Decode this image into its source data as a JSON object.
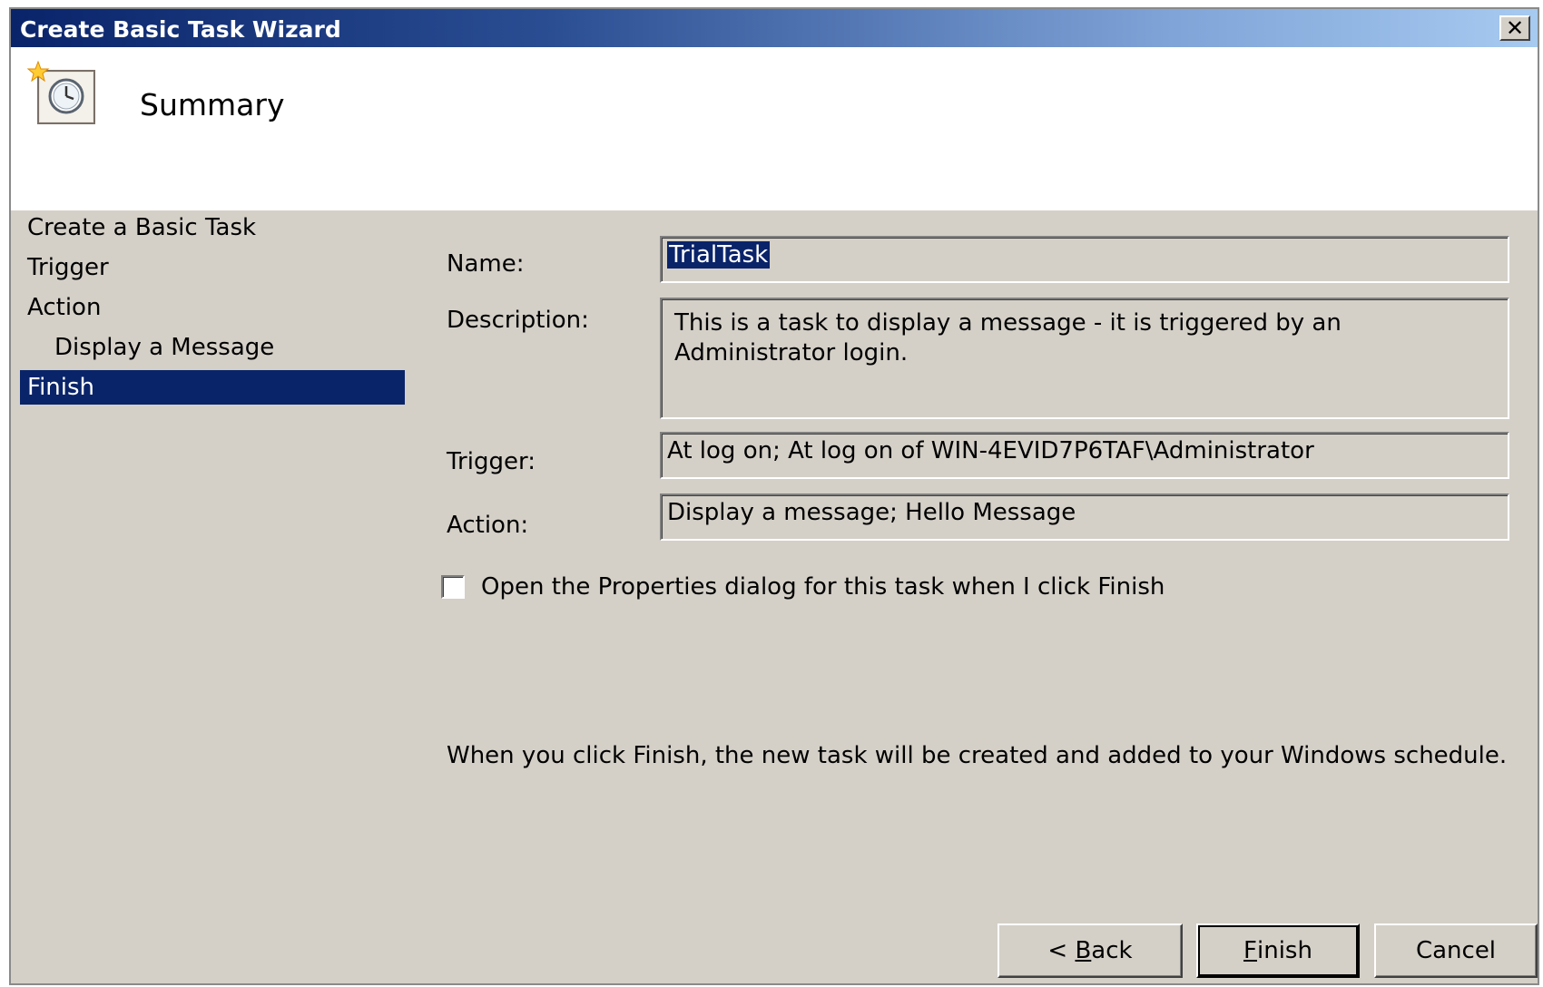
{
  "window": {
    "title": "Create Basic Task Wizard",
    "close_label": "✕"
  },
  "header": {
    "page_title": "Summary"
  },
  "steps": [
    {
      "label": "Create a Basic Task",
      "level": 0,
      "active": false
    },
    {
      "label": "Trigger",
      "level": 0,
      "active": false
    },
    {
      "label": "Action",
      "level": 0,
      "active": false
    },
    {
      "label": "Display a Message",
      "level": 1,
      "active": false
    },
    {
      "label": "Finish",
      "level": 0,
      "active": true
    }
  ],
  "form": {
    "name_label": "Name:",
    "name_value": "TrialTask",
    "description_label": "Description:",
    "description_value": "This is a task to display a message - it is triggered by an Administrator login.",
    "trigger_label": "Trigger:",
    "trigger_value": "At log on; At log on of WIN-4EVID7P6TAF\\Administrator",
    "action_label": "Action:",
    "action_value": "Display a message; Hello Message",
    "open_properties_label": "Open the Properties dialog for this task when I click Finish",
    "open_properties_checked": false
  },
  "info_text": "When you click Finish, the new task will be created and added to your Windows schedule.",
  "buttons": {
    "back": {
      "prefix": "< ",
      "mnemonic": "B",
      "rest": "ack"
    },
    "finish": {
      "prefix": "",
      "mnemonic": "F",
      "rest": "inish"
    },
    "cancel": {
      "label": "Cancel"
    }
  },
  "colors": {
    "title_bar_start": "#0a246a",
    "title_bar_end": "#a6caf0",
    "selection": "#0a246a",
    "dialog_face": "#d4d0c8"
  },
  "icons": {
    "wizard": "scheduled-task-clock-icon",
    "close": "close-icon"
  }
}
